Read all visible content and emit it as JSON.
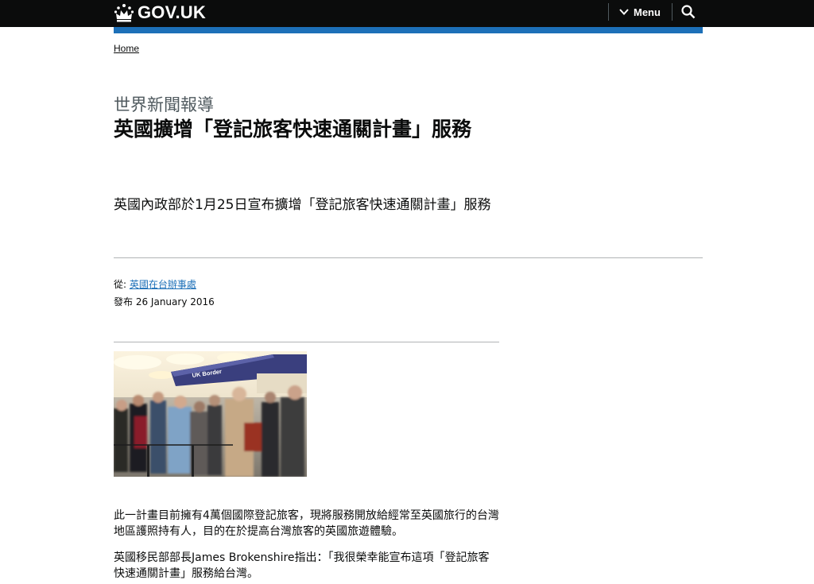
{
  "header": {
    "logo_text": "GOV.UK",
    "menu_label": "Menu",
    "logo_icon": "crown-icon",
    "search_icon": "search-icon"
  },
  "breadcrumb": {
    "home": "Home"
  },
  "article": {
    "caption": "世界新聞報導",
    "title": "英國擴增「登記旅客快速通關計畫」服務",
    "lead": "英國內政部於1月25日宣布擴增「登記旅客快速通關計畫」服務",
    "from_label": "從:",
    "from_org": "英國在台辦事處",
    "published_label": "發布",
    "published_date": "26 January 2016",
    "image_sign": "UK Border",
    "paragraphs": [
      "此一計畫目前擁有4萬個國際登記旅客，現將服務開放給經常至英國旅行的台灣地區護照持有人，目的在於提高台灣旅客的英國旅遊體驗。",
      "英國移民部部長James Brokenshire指出：「我很榮幸能宣布這項「登記旅客快速通關計畫」服務給台灣。"
    ]
  },
  "colors": {
    "header_bg": "#0b0c0c",
    "accent_blue": "#1d70b8",
    "caption_grey": "#505a5f",
    "rule_grey": "#b1b4b6"
  }
}
